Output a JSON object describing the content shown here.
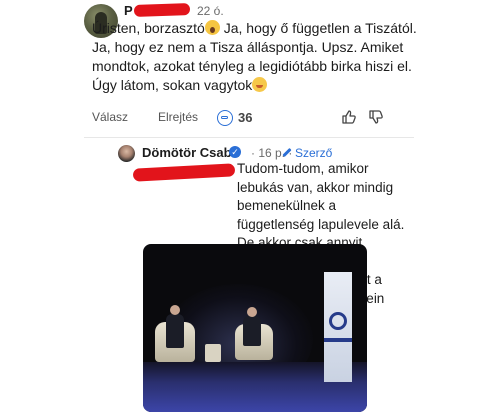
{
  "comment1": {
    "author_visible": "P",
    "time": "22 ó.",
    "text_part1": "Úristen, borzasztó",
    "text_part2": " Ja, hogy ő független a Tiszától. Ja, hogy ez nem a Tisza álláspontja. Upsz. Amiket mondtok, azokat tényleg a legidiótább birka hiszi el. Úgy látom, sokan vagytok",
    "emoji1": "screaming-face-emoji",
    "emoji2": "blushing-face-emoji",
    "actions": {
      "reply": "Válasz",
      "hide": "Elrejtés",
      "likes": "36"
    }
  },
  "reply": {
    "author": "Dömötör Csaba",
    "verified_mark": "✓",
    "time": "· 16 p. ·",
    "author_tag": "Szerző",
    "text": "Tudom-tudom, amikor lebukás van, akkor mindig bemenekülnek a függetlenség lapulevele alá. De akkor csak annyit kérdezek, hogy a függetlenek miért pont a Tisza kampánygyűlésein adnak elő?"
  },
  "colors": {
    "redaction": "#e2141b",
    "accent": "#2b6fd6",
    "text": "#1c1c1c"
  },
  "icons": {
    "link_reaction": "link-icon",
    "like": "thumbs-up-icon",
    "dislike": "thumbs-down-icon",
    "author": "pencil-icon"
  }
}
